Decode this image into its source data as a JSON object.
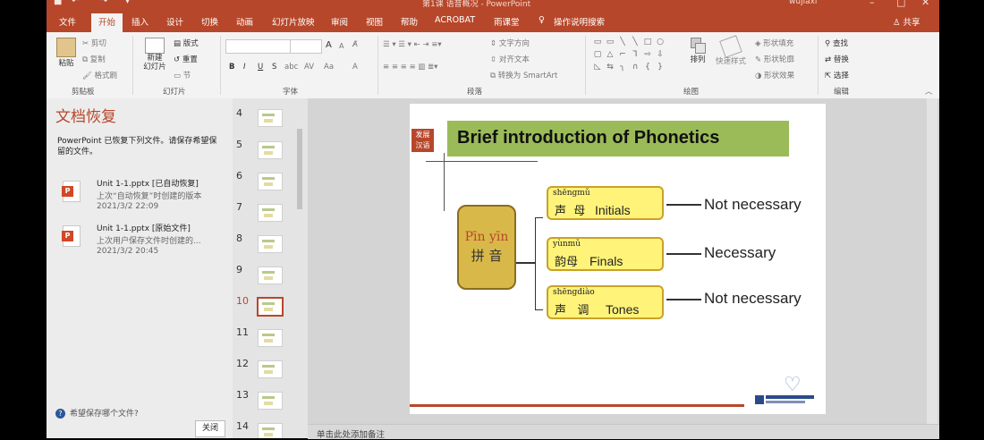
{
  "titlebar": {
    "doc_title": "第1课 语音概况 - PowerPoint",
    "user": "wujiaxi",
    "qa_icons": [
      "save-icon",
      "undo-icon",
      "redo-icon",
      "customize-icon"
    ],
    "window_controls": [
      "minimize-icon",
      "restore-icon",
      "close-icon"
    ]
  },
  "tabs": [
    "文件",
    "开始",
    "插入",
    "设计",
    "切换",
    "动画",
    "幻灯片放映",
    "审阅",
    "视图",
    "帮助",
    "ACROBAT",
    "雨课堂"
  ],
  "active_tab": "开始",
  "tell_me": "操作说明搜索",
  "share": "共享",
  "ribbon": {
    "clipboard": {
      "label": "剪贴板",
      "paste": "粘贴",
      "cut": "剪切",
      "copy": "复制",
      "format_painter": "格式刷"
    },
    "slides": {
      "label": "幻灯片",
      "new_slide": "新建\n幻灯片",
      "layout": "版式",
      "reset": "重置",
      "section": "节"
    },
    "font": {
      "label": "字体",
      "bold": "B",
      "italic": "I",
      "underline": "U",
      "strike": "S",
      "shadow": "abc",
      "spacing": "AV",
      "case": "Aa",
      "color": "A",
      "grow": "A",
      "shrink": "A"
    },
    "paragraph": {
      "label": "段落",
      "text_direction": "文字方向",
      "align_text": "对齐文本",
      "smartart": "转换为 SmartArt"
    },
    "drawing": {
      "label": "绘图",
      "arrange": "排列",
      "quick_styles": "快速样式",
      "fill": "形状填充",
      "outline": "形状轮廓",
      "effects": "形状效果"
    },
    "editing": {
      "label": "编辑",
      "find": "查找",
      "replace": "替换",
      "select": "选择"
    }
  },
  "recovery": {
    "title": "文档恢复",
    "description": "PowerPoint 已恢复下列文件。请保存希望保留的文件。",
    "files": [
      {
        "name": "Unit 1-1.pptx  [已自动恢复]",
        "status": "上次“自动恢复”时创建的版本",
        "date": "2021/3/2 22:09"
      },
      {
        "name": "Unit 1-1.pptx  [原始文件]",
        "status": "上次用户保存文件时创建的...",
        "date": "2021/3/2 20:45"
      }
    ],
    "help": "希望保存哪个文件?",
    "close": "关闭"
  },
  "thumbnails": {
    "numbers": [
      "4",
      "5",
      "6",
      "7",
      "8",
      "9",
      "10",
      "11",
      "12",
      "13",
      "14"
    ],
    "selected": "10"
  },
  "slide": {
    "logo_text": "发展\n汉语",
    "title": "Brief introduction of Phonetics",
    "center_pinyin": "Pīn yīn",
    "center_hanzi": "拼 音",
    "items": [
      {
        "pinyin": "shēngmǔ",
        "chinese": "声  母",
        "english": "Initials",
        "note": "Not necessary"
      },
      {
        "pinyin": "yùnmǔ",
        "chinese": "韵母",
        "english": "Finals",
        "note": "Necessary"
      },
      {
        "pinyin": "shēngdiào",
        "chinese": "声   调",
        "english": "Tones",
        "note": "Not necessary"
      }
    ]
  },
  "notes_placeholder": "单击此处添加备注",
  "colors": {
    "accent": "#b7472a",
    "title_bar": "#9bbb59",
    "box_fill": "#fff37a",
    "center_fill": "#d9b84a"
  }
}
